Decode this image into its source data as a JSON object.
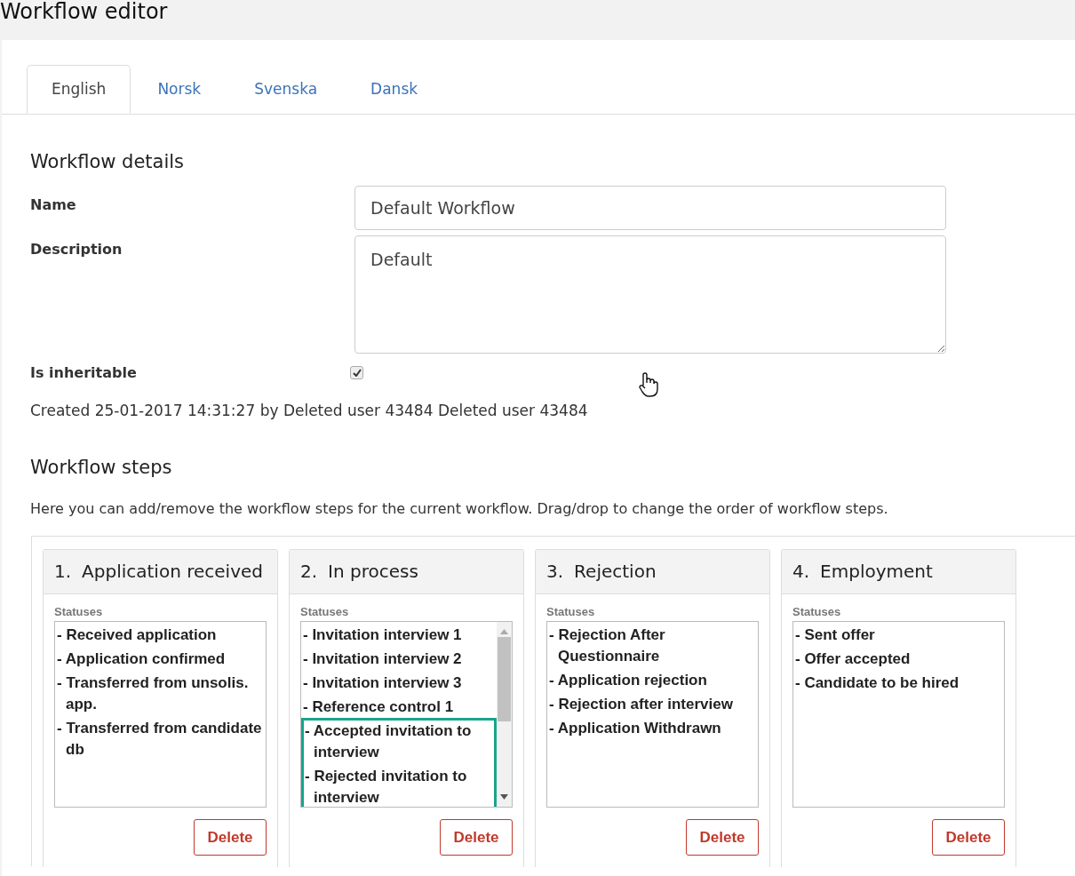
{
  "page_title": "Workflow editor",
  "tabs": [
    {
      "label": "English",
      "selected": true
    },
    {
      "label": "Norsk",
      "selected": false
    },
    {
      "label": "Svenska",
      "selected": false
    },
    {
      "label": "Dansk",
      "selected": false
    }
  ],
  "details": {
    "heading": "Workflow details",
    "name_label": "Name",
    "name_value": "Default Workflow",
    "description_label": "Description",
    "description_value": "Default",
    "inheritable_label": "Is inheritable",
    "inheritable_checked": true,
    "created_text": "Created 25-01-2017 14:31:27 by Deleted user 43484 Deleted user 43484"
  },
  "steps_section": {
    "heading": "Workflow steps",
    "description": "Here you can add/remove the workflow steps for the current workflow. Drag/drop to change the order of workflow steps.",
    "steps": [
      {
        "number": "1.",
        "title": "Application received",
        "statuses_label": "Statuses",
        "scrollable": false,
        "delete_label": "Delete",
        "statuses": [
          {
            "text": "- Received application",
            "highlighted": false
          },
          {
            "text": "- Application confirmed",
            "highlighted": false
          },
          {
            "text": "- Transferred from unsolis. app.",
            "highlighted": false
          },
          {
            "text": "- Transferred from candidate db",
            "highlighted": false
          }
        ]
      },
      {
        "number": "2.",
        "title": "In process",
        "statuses_label": "Statuses",
        "scrollable": true,
        "delete_label": "Delete",
        "statuses": [
          {
            "text": "- Invitation interview 1",
            "highlighted": false
          },
          {
            "text": "- Invitation interview 2",
            "highlighted": false
          },
          {
            "text": "- Invitation interview 3",
            "highlighted": false
          },
          {
            "text": "- Reference control 1",
            "highlighted": false
          },
          {
            "text": "- Accepted invitation to interview",
            "highlighted": true
          },
          {
            "text": "- Rejected invitation to interview",
            "highlighted": true
          }
        ]
      },
      {
        "number": "3.",
        "title": "Rejection",
        "statuses_label": "Statuses",
        "scrollable": false,
        "delete_label": "Delete",
        "statuses": [
          {
            "text": "- Rejection After Questionnaire",
            "highlighted": false
          },
          {
            "text": "- Application rejection",
            "highlighted": false
          },
          {
            "text": "- Rejection after interview",
            "highlighted": false
          },
          {
            "text": "- Application Withdrawn",
            "highlighted": false
          }
        ]
      },
      {
        "number": "4.",
        "title": "Employment",
        "statuses_label": "Statuses",
        "scrollable": false,
        "delete_label": "Delete",
        "statuses": [
          {
            "text": "- Sent offer",
            "highlighted": false
          },
          {
            "text": "- Offer accepted",
            "highlighted": false
          },
          {
            "text": "- Candidate to be hired",
            "highlighted": false
          }
        ]
      }
    ]
  }
}
